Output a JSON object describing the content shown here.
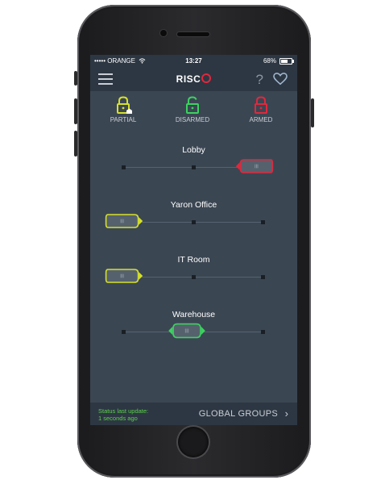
{
  "status_bar": {
    "carrier": "••••• ORANGE",
    "wifi_icon": "wifi-icon",
    "time": "13:27",
    "battery": "68%",
    "battery_level": 0.68
  },
  "nav": {
    "menu_icon": "hamburger-menu-icon",
    "logo": "RISC",
    "help": "?",
    "favorites_icon": "heart-icon"
  },
  "modes": [
    {
      "label": "PARTIAL",
      "color": "#d6e02a",
      "icon": "partial-lock-icon"
    },
    {
      "label": "DISARMED",
      "color": "#3dd160",
      "icon": "unlocked-lock-icon"
    },
    {
      "label": "ARMED",
      "color": "#e0283c",
      "icon": "locked-lock-icon"
    }
  ],
  "partitions": [
    {
      "name": "Lobby",
      "state": "armed",
      "color": "#e0283c",
      "position": "right"
    },
    {
      "name": "Yaron Office",
      "state": "partial",
      "color": "#d6e02a",
      "position": "left"
    },
    {
      "name": "IT Room",
      "state": "partial",
      "color": "#d6e02a",
      "position": "left"
    },
    {
      "name": "Warehouse",
      "state": "disarmed",
      "color": "#3dd160",
      "position": "center"
    }
  ],
  "footer": {
    "status_line1": "Status last update:",
    "status_line2": "1 seconds ago",
    "global_groups": "GLOBAL GROUPS",
    "chevron": "›"
  }
}
